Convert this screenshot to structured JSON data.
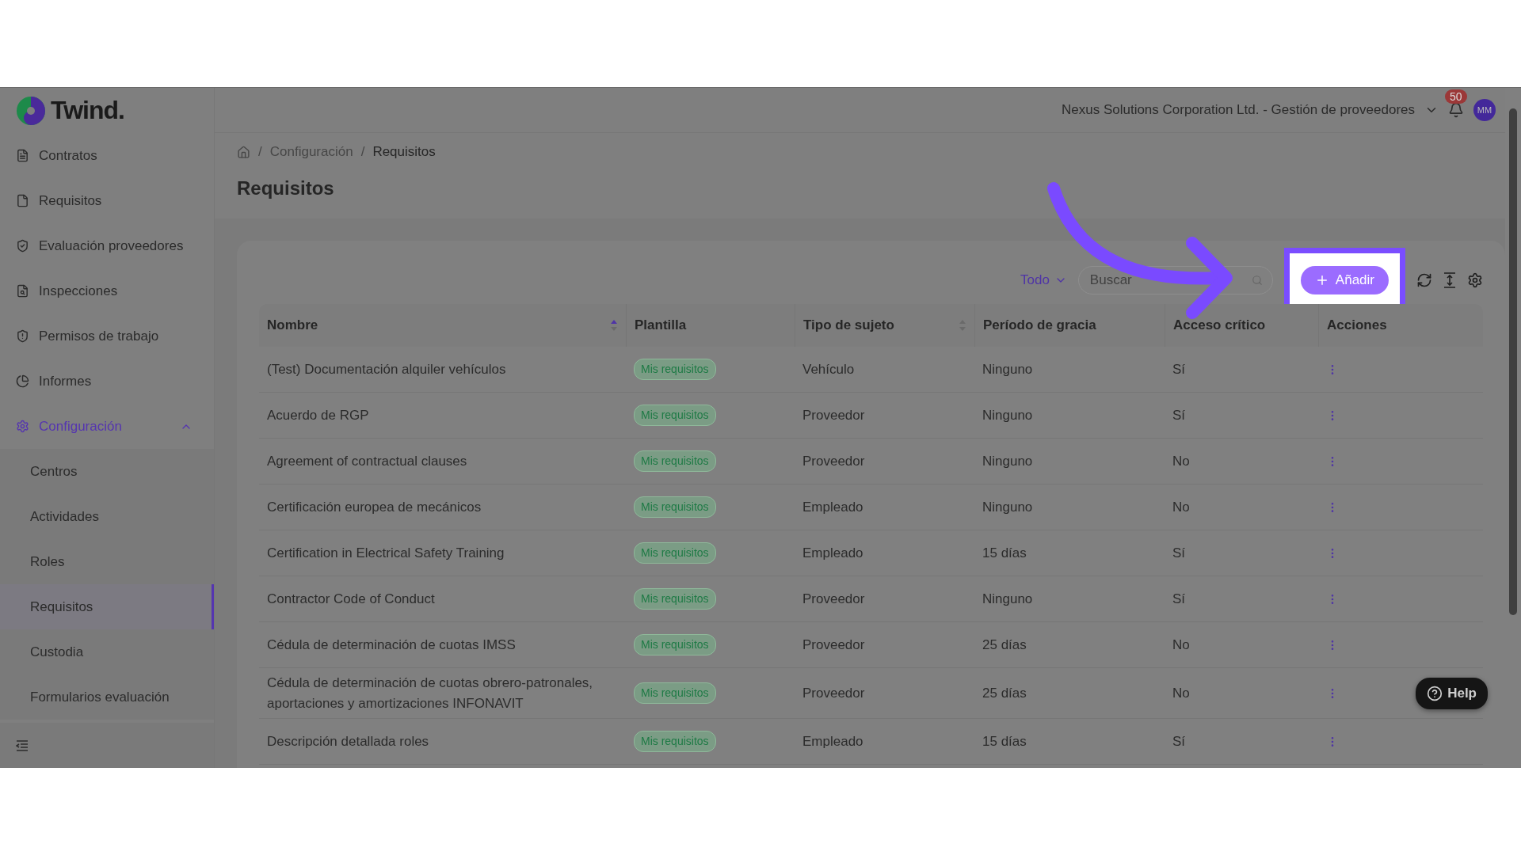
{
  "logo": {
    "text": "Twind."
  },
  "sidebar": {
    "items": [
      {
        "label": "Contratos",
        "selected": false
      },
      {
        "label": "Requisitos",
        "selected": false
      },
      {
        "label": "Evaluación proveedores",
        "selected": false
      },
      {
        "label": "Inspecciones",
        "selected": false
      },
      {
        "label": "Permisos de trabajo",
        "selected": false
      },
      {
        "label": "Informes",
        "selected": false
      },
      {
        "label": "Configuración",
        "selected": true,
        "expanded": true,
        "children": [
          {
            "label": "Centros",
            "selected": false
          },
          {
            "label": "Actividades",
            "selected": false
          },
          {
            "label": "Roles",
            "selected": false
          },
          {
            "label": "Requisitos",
            "selected": true
          },
          {
            "label": "Custodia",
            "selected": false
          },
          {
            "label": "Formularios evaluación",
            "selected": false
          }
        ]
      }
    ]
  },
  "header": {
    "workspace": "Nexus Solutions Corporation Ltd. - Gestión de proveedores",
    "notifications": "50",
    "avatar": "MM"
  },
  "breadcrumbs": [
    {
      "separator": "/",
      "label": "Configuración"
    },
    {
      "separator": "/",
      "label": "Requisitos"
    }
  ],
  "page_title": "Requisitos",
  "toolbar": {
    "filter": "Todo",
    "search": {
      "placeholder": "Buscar"
    },
    "add_button": "Añadir",
    "highlighted": true
  },
  "table": {
    "columns": [
      {
        "label": "Nombre",
        "sortable": true,
        "sorted": true
      },
      {
        "label": "Plantilla",
        "sortable": false,
        "sorted": false
      },
      {
        "label": "Tipo de sujeto",
        "sortable": true,
        "sorted": false
      },
      {
        "label": "Período de gracia",
        "sortable": false,
        "sorted": false
      },
      {
        "label": "Acceso crítico",
        "sortable": false,
        "sorted": false
      },
      {
        "label": "Acciones",
        "sortable": false,
        "sorted": false
      }
    ],
    "rows": [
      {
        "name": "(Test) Documentación alquiler vehículos",
        "template": "Mis requisitos",
        "subject": "Vehículo",
        "grace": "Ninguno",
        "critical": "Sí"
      },
      {
        "name": "Acuerdo de RGP",
        "template": "Mis requisitos",
        "subject": "Proveedor",
        "grace": "Ninguno",
        "critical": "Sí"
      },
      {
        "name": "Agreement of contractual clauses",
        "template": "Mis requisitos",
        "subject": "Proveedor",
        "grace": "Ninguno",
        "critical": "No"
      },
      {
        "name": "Certificación europea de mecánicos",
        "template": "Mis requisitos",
        "subject": "Empleado",
        "grace": "Ninguno",
        "critical": "No"
      },
      {
        "name": "Certification in Electrical Safety Training",
        "template": "Mis requisitos",
        "subject": "Empleado",
        "grace": "15 días",
        "critical": "Sí"
      },
      {
        "name": "Contractor Code of Conduct",
        "template": "Mis requisitos",
        "subject": "Proveedor",
        "grace": "Ninguno",
        "critical": "Sí"
      },
      {
        "name": "Cédula de determinación de cuotas IMSS",
        "template": "Mis requisitos",
        "subject": "Proveedor",
        "grace": "25 días",
        "critical": "No"
      },
      {
        "name": "Cédula de determinación de cuotas obrero-patronales, aportaciones y amortizaciones INFONAVIT",
        "template": "Mis requisitos",
        "subject": "Proveedor",
        "grace": "25 días",
        "critical": "No"
      },
      {
        "name": "Descripción detallada roles",
        "template": "Mis requisitos",
        "subject": "Empleado",
        "grace": "15 días",
        "critical": "Sí"
      }
    ]
  },
  "help_button": "Help"
}
